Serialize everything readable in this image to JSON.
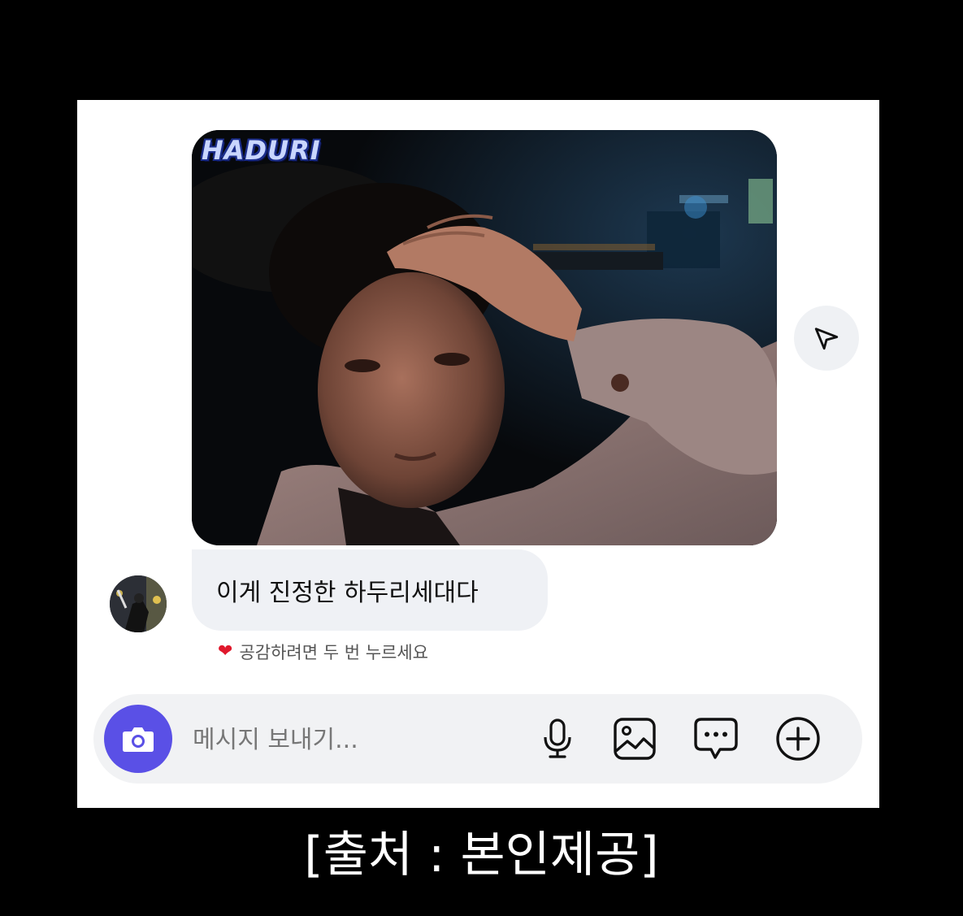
{
  "chat": {
    "image_watermark": "HADURI",
    "message_text": "이게 진정한 하두리세대다",
    "like_hint": "공감하려면 두 번 누르세요",
    "heart_icon": "heart-icon"
  },
  "composer": {
    "placeholder": "메시지 보내기...",
    "accent_color": "#5a50e6"
  },
  "caption": "[출처 : 본인제공]"
}
